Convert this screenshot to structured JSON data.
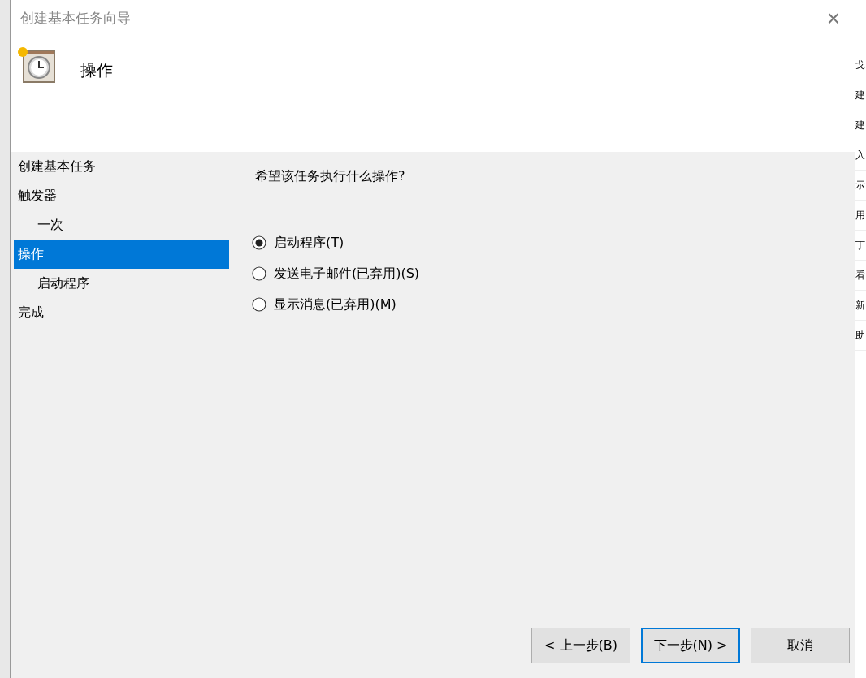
{
  "window": {
    "title": "创建基本任务向导",
    "close": "×"
  },
  "header": {
    "title": "操作"
  },
  "steps": [
    {
      "label": "创建基本任务",
      "selected": false
    },
    {
      "label": "触发器",
      "selected": false,
      "children": [
        {
          "label": "一次",
          "selected": false
        }
      ]
    },
    {
      "label": "操作",
      "selected": true,
      "children": [
        {
          "label": "启动程序",
          "selected": false
        }
      ]
    },
    {
      "label": "完成",
      "selected": false
    }
  ],
  "question": "希望该任务执行什么操作?",
  "options": [
    {
      "label": "启动程序(T)",
      "selected": true
    },
    {
      "label": "发送电子邮件(已弃用)(S)",
      "selected": false
    },
    {
      "label": "显示消息(已弃用)(M)",
      "selected": false
    }
  ],
  "buttons": [
    {
      "label": "< 上一步(B)",
      "focused": false
    },
    {
      "label": "下一步(N) >",
      "focused": true
    },
    {
      "label": "取消",
      "focused": false
    }
  ],
  "background_panel": {
    "items": [
      "戈",
      "建",
      "建",
      "入",
      "示",
      "用",
      "丁",
      "看",
      "新",
      "助"
    ]
  }
}
